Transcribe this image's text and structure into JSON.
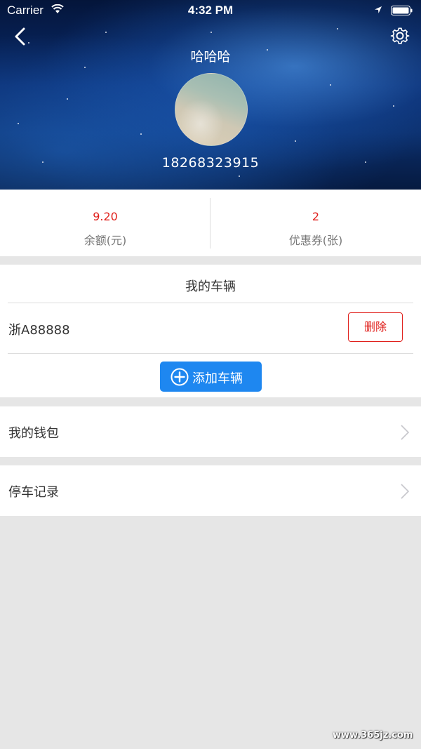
{
  "status_bar": {
    "carrier": "Carrier",
    "time": "4:32 PM"
  },
  "profile": {
    "username": "哈哈哈",
    "phone": "18268323915"
  },
  "stats": {
    "balance_value": "9.20",
    "balance_label": "余额(元)",
    "coupons_value": "2",
    "coupons_label": "优惠券(张)"
  },
  "vehicles": {
    "title": "我的车辆",
    "items": [
      {
        "plate": "浙A88888",
        "delete_label": "删除"
      }
    ],
    "add_label": "添加车辆"
  },
  "menu": [
    {
      "label": "我的钱包"
    },
    {
      "label": "停车记录"
    }
  ],
  "watermark": "www.365jz.com",
  "colors": {
    "accent_red": "#e0201c",
    "button_blue": "#1e87f0",
    "background": "#e6e6e6"
  }
}
